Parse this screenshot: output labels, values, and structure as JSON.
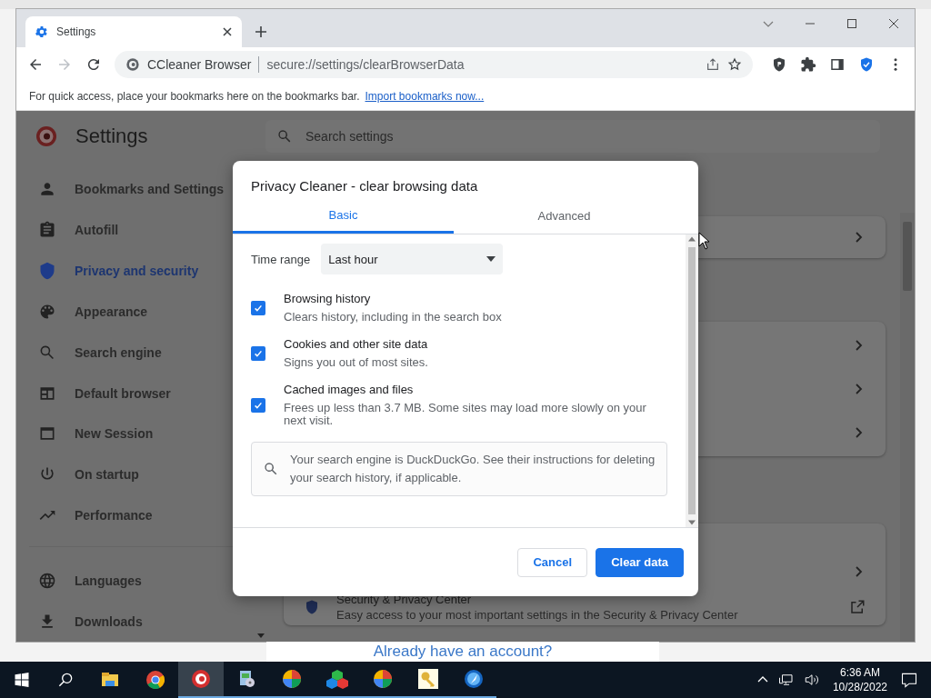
{
  "browser": {
    "tabs": [
      {
        "title": "Settings",
        "selected": true
      }
    ],
    "toolbar": {
      "back_enabled": true,
      "forward_enabled": false,
      "site_label": "CCleaner Browser",
      "url": "secure://settings/clearBrowserData"
    },
    "bookmarks_bar": {
      "text": "For quick access, place your bookmarks here on the bookmarks bar.",
      "link": "Import bookmarks now..."
    }
  },
  "settings": {
    "title": "Settings",
    "search": {
      "placeholder": "Search settings"
    },
    "sidebar": {
      "items": [
        {
          "label": "Bookmarks and Settings",
          "selected": false
        },
        {
          "label": "Autofill",
          "selected": false
        },
        {
          "label": "Privacy and security",
          "selected": true
        },
        {
          "label": "Appearance",
          "selected": false
        },
        {
          "label": "Search engine",
          "selected": false
        },
        {
          "label": "Default browser",
          "selected": false
        },
        {
          "label": "New Session",
          "selected": false
        },
        {
          "label": "On startup",
          "selected": false
        },
        {
          "label": "Performance",
          "selected": false
        }
      ],
      "more_items": [
        {
          "label": "Languages",
          "selected": false
        },
        {
          "label": "Downloads",
          "selected": false
        }
      ]
    },
    "security_row": {
      "title": "Security & Privacy Center",
      "description": "Easy access to your most important settings in the Security & Privacy Center"
    }
  },
  "dialog": {
    "title": "Privacy Cleaner - clear browsing data",
    "tabs": [
      {
        "label": "Basic",
        "selected": true
      },
      {
        "label": "Advanced",
        "selected": false
      }
    ],
    "time_range": {
      "label": "Time range",
      "value": "Last hour"
    },
    "options": [
      {
        "title": "Browsing history",
        "description": "Clears history, including in the search box",
        "checked": true
      },
      {
        "title": "Cookies and other site data",
        "description": "Signs you out of most sites.",
        "checked": true
      },
      {
        "title": "Cached images and files",
        "description": "Frees up less than 3.7 MB. Some sites may load more slowly on your next visit.",
        "checked": true
      }
    ],
    "info": "Your search engine is DuckDuckGo. See their instructions for deleting your search history, if applicable.",
    "buttons": [
      {
        "label": "Cancel",
        "kind": "secondary"
      },
      {
        "label": "Clear data",
        "kind": "primary"
      }
    ]
  },
  "background_page": {
    "link": "Already have an account?"
  },
  "taskbar": {
    "apps": [
      {
        "running": false,
        "active": false
      },
      {
        "running": false,
        "active": false
      },
      {
        "running": true,
        "active": true
      },
      {
        "running": true,
        "active": false
      },
      {
        "running": true,
        "active": false
      },
      {
        "running": true,
        "active": false
      },
      {
        "running": true,
        "active": false
      },
      {
        "running": true,
        "active": false
      },
      {
        "running": true,
        "active": false
      }
    ],
    "time": "6:36 AM",
    "date": "10/28/2022"
  }
}
